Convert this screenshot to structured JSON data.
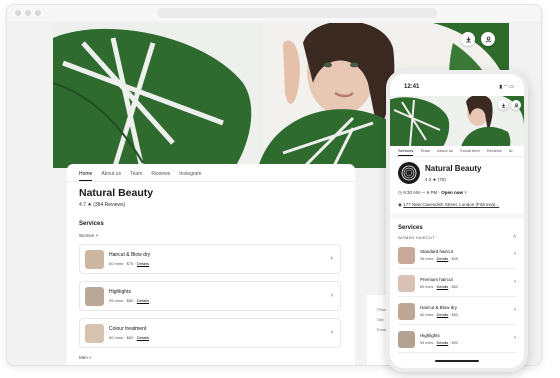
{
  "hero": {
    "action_icons": [
      "download-icon",
      "user-icon"
    ]
  },
  "desktop": {
    "tabs": [
      "Home",
      "About us",
      "Team",
      "Reviews",
      "Instagram"
    ],
    "title": "Natural Beauty",
    "rating": "4.7",
    "reviews": "(384 Reviews)",
    "services_heading": "Services",
    "group_label": "Women",
    "services": [
      {
        "name": "Haircut & Blow dry",
        "duration": "60 mins",
        "price": "$75",
        "details": "Details"
      },
      {
        "name": "Highlights",
        "duration": "95 mins",
        "price": "$80",
        "details": "Details"
      },
      {
        "name": "Colour treatment",
        "duration": "60 mins",
        "price": "$60",
        "details": "Details"
      }
    ],
    "more_label": "Men"
  },
  "side": {
    "rows": [
      "Phone",
      "Site",
      "Email"
    ]
  },
  "phone": {
    "time": "12:41",
    "tabs": [
      "Services",
      "Team",
      "About us",
      "Social feed",
      "Reviews",
      "Ar"
    ],
    "title": "Natural Beauty",
    "rating": "4.2",
    "reviews": "(78)",
    "hours": "9:30 AM — 6 PM",
    "open_status": "Open now",
    "address": "177 New Cavendish Street, London (Fitzrovia)...",
    "services_heading": "Services",
    "group_label": "WOMEN HAIRCUT",
    "services": [
      {
        "name": "Standard haircut",
        "duration": "35 mins",
        "price": "$45",
        "details": "Details"
      },
      {
        "name": "Premium haircut",
        "duration": "60 mins",
        "price": "$80",
        "details": "Details"
      },
      {
        "name": "Haircut & Blow dry",
        "duration": "60 mins",
        "price": "$80",
        "details": "Details"
      },
      {
        "name": "Highlights",
        "duration": "95 mins",
        "price": "$90",
        "details": "Details"
      }
    ]
  },
  "colors": {
    "accent": "#111111",
    "leaf": "#2f6b2e",
    "leaf_dark": "#1f4f22",
    "background": "#f2f2f2"
  }
}
